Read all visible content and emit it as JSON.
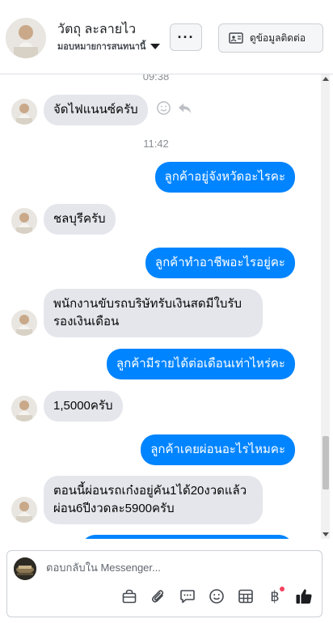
{
  "header": {
    "name": "วัตถุ ละลายไว",
    "subtitle": "มอบหมายการสนทนานี้",
    "more_label": "···",
    "contact_label": "ดูข้อมูลติดต่อ"
  },
  "messages": {
    "top_time": "09:38",
    "m1": "จัดไฟแนนซ์ครับ",
    "time2": "11:42",
    "m2": "ลูกค้าอยู่จังหวัดอะไรคะ",
    "m3": "ชลบุรีครับ",
    "m4": "ลูกค้าทำอาชีพอะไรอยู่คะ",
    "m5_line1": "พนักงานขับรถบริษัทรับเงินสดมีใบรับ",
    "m5_line2": "รองเงินเดือน",
    "m6": "ลูกค้ามีรายได้ต่อเดือนเท่าไหร่คะ",
    "m7": "1,5000ครับ",
    "m8": "ลูกค้าเคยผ่อนอะไรไหมคะ",
    "m9_line1": "ตอนนี้ผ่อนรถเก๋งอยู่คัน1ได้20งวดแล้ว",
    "m9_line2": "ผ่อน6ปีงวดละ5900ครับ"
  },
  "composer": {
    "placeholder": "ตอบกลับใน Messenger...",
    "baht_symbol": "฿"
  },
  "colors": {
    "outgoing": "#0084ff",
    "incoming": "#e4e6eb",
    "notification_dot": "#f3425f"
  },
  "icons": [
    "smile-icon",
    "reply-icon",
    "id-card-icon",
    "bag-icon",
    "paperclip-icon",
    "chat-bubble-icon",
    "emoji-icon",
    "table-icon",
    "baht-icon",
    "thumbs-up-icon"
  ]
}
